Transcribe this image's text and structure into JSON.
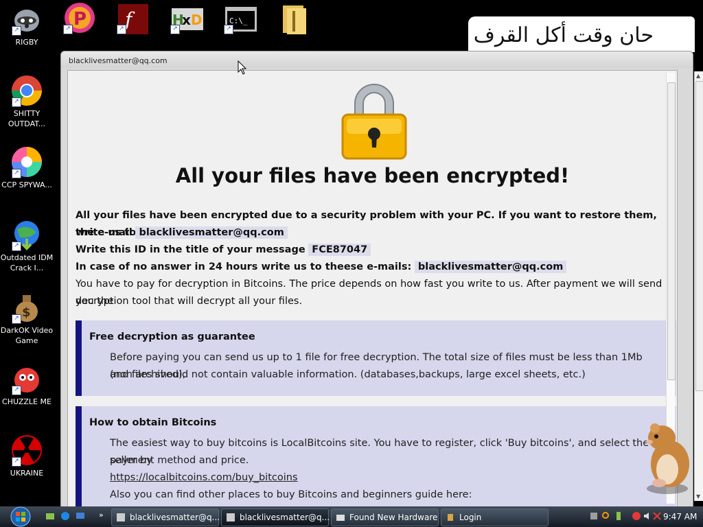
{
  "desktop_icons": [
    {
      "label": "RIGBY"
    },
    {
      "label": "SHITTY OUTDAT..."
    },
    {
      "label": "CCP SPYWA..."
    },
    {
      "label": "Outdated IDM Crack I..."
    },
    {
      "label": "DarkOK Video Game"
    },
    {
      "label": "CHUZZLE ME"
    },
    {
      "label": "UKRAINE"
    }
  ],
  "banner_text": "حان وقت أكل القرف",
  "window": {
    "title": "blacklivesmatter@qq.com",
    "headline": "All your files have been encrypted!",
    "intro_line1": "All your files have been encrypted due to a security problem with your PC. If you want to restore them, write us to",
    "intro_line2_prefix": "the e-mail",
    "email": "blacklivesmatter@qq.com",
    "id_prefix": "Write this ID in the title of your message",
    "id_value": "FCE87047",
    "noanswer_prefix": "In case of no answer in 24 hours write us to theese e-mails:",
    "noanswer_email": "blacklivesmatter@qq.com",
    "pay_line1": "You have to pay for decryption in Bitcoins. The price depends on how fast you write to us. After payment we will send you the",
    "pay_line2": "decryption tool that will decrypt all your files.",
    "box1": {
      "title": "Free decryption as guarantee",
      "line1": "Before paying you can send us up to 1 file for free decryption. The total size of files must be less than 1Mb (non archived),",
      "line2": "and files should not contain valuable information. (databases,backups, large excel sheets, etc.)"
    },
    "box2": {
      "title": "How to obtain Bitcoins",
      "line1": "The easiest way to buy bitcoins is LocalBitcoins site. You have to register, click 'Buy bitcoins', and select the seller by",
      "line2": "payment method and price.",
      "link": "https://localbitcoins.com/buy_bitcoins",
      "line3": "Also you can find other places to buy Bitcoins and beginners guide here:"
    }
  },
  "taskbar": {
    "tasks": [
      {
        "label": "blacklivesmatter@q..."
      },
      {
        "label": "blacklivesmatter@q..."
      },
      {
        "label": "Found New Hardware"
      },
      {
        "label": "Login"
      }
    ],
    "clock": "9:47 AM"
  },
  "colors": {
    "box_bg": "#d6d6ec",
    "box_border": "#141482",
    "link": "#1133cc"
  }
}
